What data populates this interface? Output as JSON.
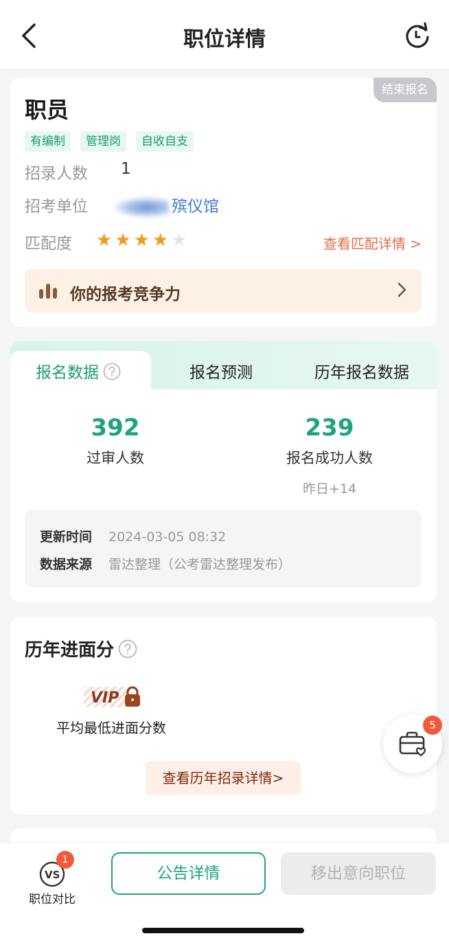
{
  "header": {
    "title": "职位详情"
  },
  "job": {
    "status": "结束报名",
    "title": "职员",
    "tags": [
      "有编制",
      "管理岗",
      "自收自支"
    ],
    "count_label": "招录人数",
    "count_value": "1",
    "unit_label": "招考单位",
    "unit_value": "殡仪馆",
    "match_label": "匹配度",
    "match_stars": 4,
    "match_stars_max": 5,
    "match_link": "查看匹配详情 >",
    "compete_label": "你的报考竞争力"
  },
  "stats": {
    "tabs": [
      "报名数据",
      "报名预测",
      "历年报名数据"
    ],
    "passed_count": "392",
    "passed_label": "过审人数",
    "success_count": "239",
    "success_label": "报名成功人数",
    "success_delta": "昨日+14",
    "update_key": "更新时间",
    "update_value": "2024-03-05 08:32",
    "source_key": "数据来源",
    "source_value": "雷达整理（公考雷达整理发布）"
  },
  "history": {
    "title": "历年进面分",
    "vip_text": "VIP",
    "avg_label": "平均最低进面分数",
    "detail_button": "查看历年招录详情>"
  },
  "float": {
    "badge": "5"
  },
  "bottom": {
    "compare_badge": "1",
    "compare_label": "职位对比",
    "notice_button": "公告详情",
    "remove_button": "移出意向职位"
  },
  "colors": {
    "accent": "#1ea381",
    "star": "#f39a1c",
    "link": "#e66a44",
    "badge": "#f05a3b"
  }
}
